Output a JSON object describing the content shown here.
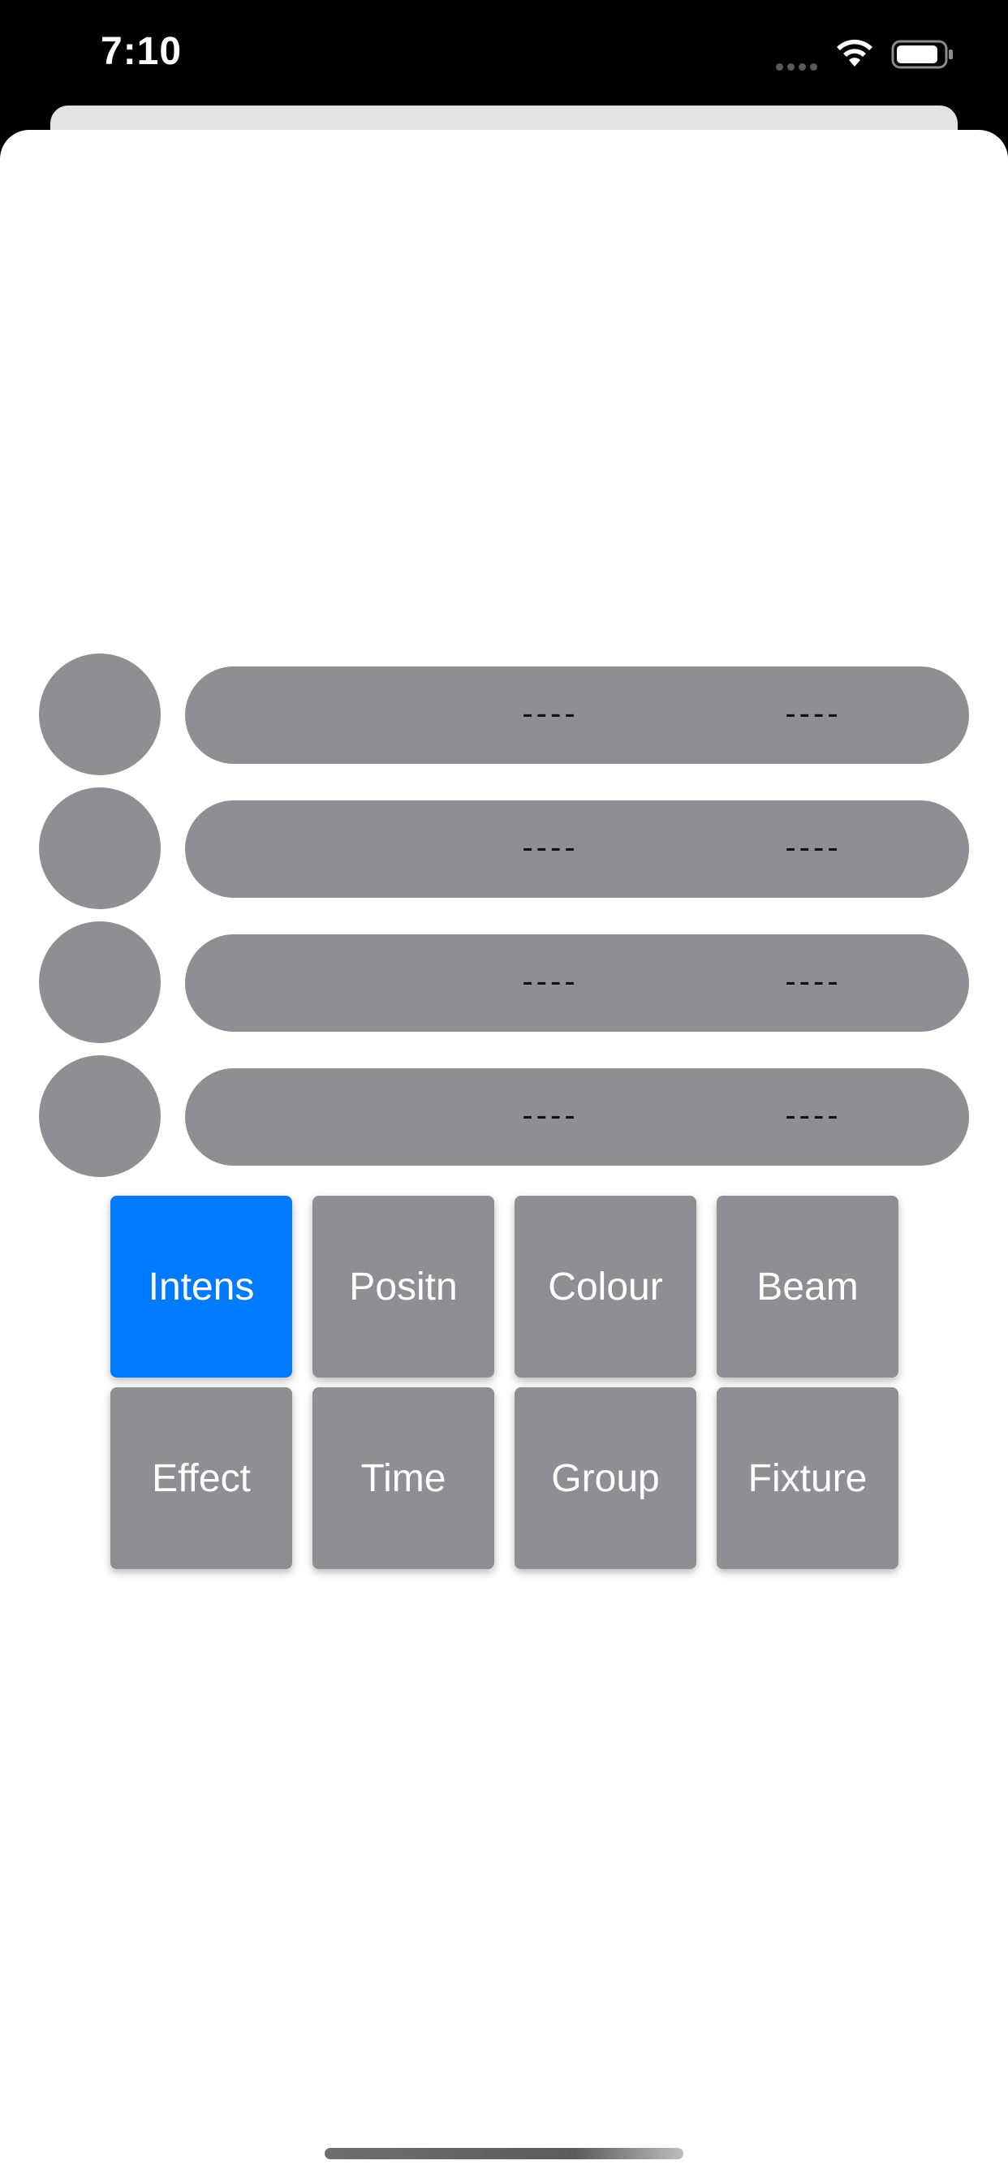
{
  "status_bar": {
    "time": "7:10"
  },
  "channels": [
    {
      "value_1": "----",
      "value_2": "----"
    },
    {
      "value_1": "----",
      "value_2": "----"
    },
    {
      "value_1": "----",
      "value_2": "----"
    },
    {
      "value_1": "----",
      "value_2": "----"
    }
  ],
  "attribute_tiles": [
    {
      "label": "Intens",
      "selected": true
    },
    {
      "label": "Positn",
      "selected": false
    },
    {
      "label": "Colour",
      "selected": false
    },
    {
      "label": "Beam",
      "selected": false
    },
    {
      "label": "Effect",
      "selected": false
    },
    {
      "label": "Time",
      "selected": false
    },
    {
      "label": "Group",
      "selected": false
    },
    {
      "label": "Fixture",
      "selected": false
    }
  ],
  "colors": {
    "accent": "#007aff",
    "tile_gray": "#8e8e93",
    "sheet_background": "#ffffff",
    "status_bar_background": "#000000"
  }
}
